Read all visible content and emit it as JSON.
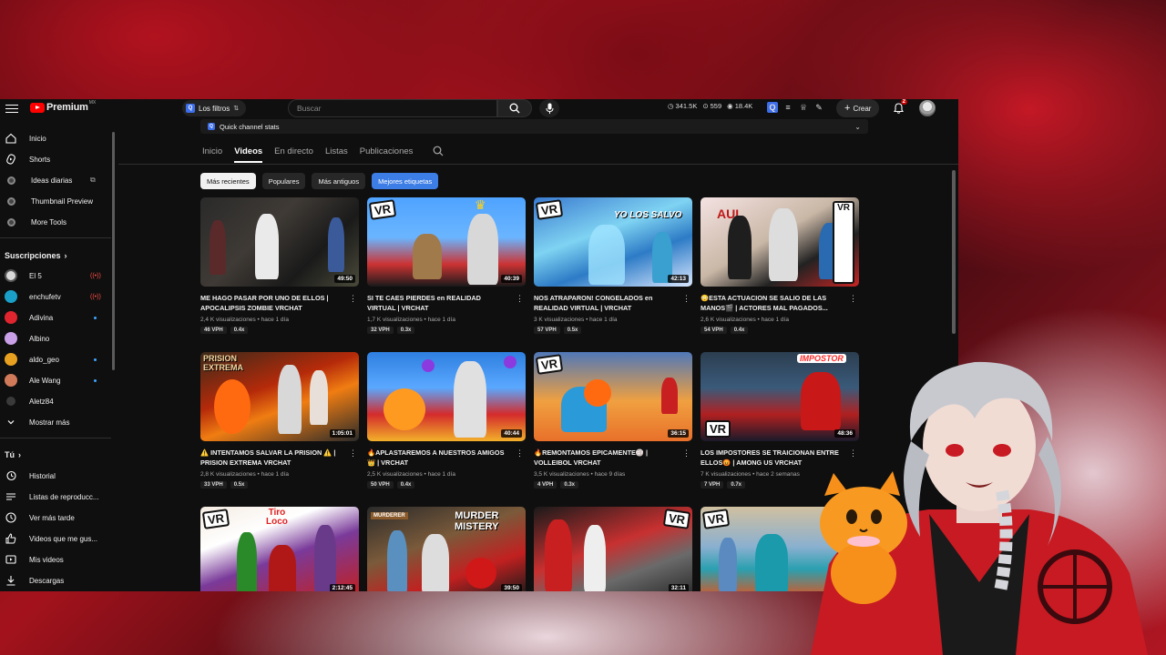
{
  "header": {
    "logo_text": "Premium",
    "logo_sup": "MX",
    "filters_label": "Los filtros",
    "search_placeholder": "Buscar",
    "stats": [
      "341.5K",
      "559",
      "18.4K"
    ],
    "create_label": "Crear",
    "notifications_count": "2"
  },
  "sidebar": {
    "main": [
      {
        "label": "Inicio",
        "icon": "home-icon"
      },
      {
        "label": "Shorts",
        "icon": "shorts-icon"
      },
      {
        "label": "Ideas diarias",
        "icon": "extension-icon"
      },
      {
        "label": "Thumbnail Preview",
        "icon": "extension-icon"
      },
      {
        "label": "More Tools",
        "icon": "extension-icon"
      }
    ],
    "subs_title": "Suscripciones",
    "subs": [
      {
        "label": "El 5",
        "status": "live",
        "color": "#d9d9d9"
      },
      {
        "label": "enchufetv",
        "status": "live",
        "color": "#1aa0c8"
      },
      {
        "label": "Adivina",
        "status": "dot",
        "color": "#e0252f"
      },
      {
        "label": "Albino",
        "status": "",
        "color": "#c9a0e8"
      },
      {
        "label": "aldo_geo",
        "status": "dot",
        "color": "#e8a020"
      },
      {
        "label": "Ale Wang",
        "status": "dot",
        "color": "#d07a5a"
      },
      {
        "label": "Aletz84",
        "status": "",
        "color": "#3a3a3a"
      }
    ],
    "show_more": "Mostrar más",
    "you_title": "Tú",
    "you": [
      {
        "label": "Historial",
        "icon": "history-icon"
      },
      {
        "label": "Listas de reproducc...",
        "icon": "playlist-icon"
      },
      {
        "label": "Ver más tarde",
        "icon": "clock-icon"
      },
      {
        "label": "Videos que me gus...",
        "icon": "thumbs-up-icon"
      },
      {
        "label": "Mis videos",
        "icon": "my-videos-icon"
      },
      {
        "label": "Descargas",
        "icon": "download-icon"
      }
    ]
  },
  "channel": {
    "quick_stats": "Quick channel stats",
    "tabs": [
      "Inicio",
      "Videos",
      "En directo",
      "Listas",
      "Publicaciones"
    ],
    "active_tab": "Videos",
    "chips": [
      "Más recientes",
      "Populares",
      "Más antiguos",
      "Mejores etiquetas"
    ]
  },
  "videos": [
    {
      "title": "ME HAGO PASAR POR UNO DE ELLOS | APOCALIPSIS ZOMBIE VRCHAT",
      "duration": "49:50",
      "views": "2,4 K visualizaciones",
      "age": "hace 1 día",
      "vph": "46 VPH",
      "ratio": "0.4x"
    },
    {
      "title": "SI TE CAES PIERDES en REALIDAD VIRTUAL | VRCHAT",
      "duration": "40:39",
      "views": "1,7 K visualizaciones",
      "age": "hace 1 día",
      "vph": "32 VPH",
      "ratio": "0.3x"
    },
    {
      "title": "NOS ATRAPARON! CONGELADOS en REALIDAD VIRTUAL | VRCHAT",
      "duration": "42:13",
      "views": "3 K visualizaciones",
      "age": "hace 1 día",
      "vph": "57 VPH",
      "ratio": "0.5x"
    },
    {
      "title": "😳ESTA ACTUACION SE SALIO DE LAS MANOS🎬 | ACTORES MAL PAGADOS...",
      "duration": "",
      "views": "2,6 K visualizaciones",
      "age": "hace 1 día",
      "vph": "54 VPH",
      "ratio": "0.4x"
    },
    {
      "title": "⚠️ INTENTAMOS SALVAR LA PRISION ⚠️ | PRISION EXTREMA VRCHAT",
      "duration": "1:05:01",
      "views": "2,8 K visualizaciones",
      "age": "hace 1 día",
      "vph": "33 VPH",
      "ratio": "0.5x"
    },
    {
      "title": "🔥APLASTAREMOS A NUESTROS AMIGOS👑 | VRCHAT",
      "duration": "40:44",
      "views": "2,5 K visualizaciones",
      "age": "hace 1 día",
      "vph": "50 VPH",
      "ratio": "0.4x"
    },
    {
      "title": "🔥REMONTAMOS EPICAMENTE🏐 | VOLLEIBOL VRCHAT",
      "duration": "36:15",
      "views": "3,5 K visualizaciones",
      "age": "hace 9 días",
      "vph": "4 VPH",
      "ratio": "0.3x"
    },
    {
      "title": "LOS IMPOSTORES SE TRAICIONAN ENTRE ELLOS😡 | AMONG US VRCHAT",
      "duration": "48:36",
      "views": "7 K visualizaciones",
      "age": "hace 2 semanas",
      "vph": "7 VPH",
      "ratio": "0.7x"
    },
    {
      "title": "",
      "duration": "2:12:45",
      "views": "",
      "age": "",
      "vph": "",
      "ratio": ""
    },
    {
      "title": "",
      "duration": "39:50",
      "views": "",
      "age": "",
      "vph": "",
      "ratio": ""
    },
    {
      "title": "",
      "duration": "32:11",
      "views": "",
      "age": "",
      "vph": "",
      "ratio": ""
    },
    {
      "title": "",
      "duration": "",
      "views": "",
      "age": "",
      "vph": "",
      "ratio": ""
    }
  ],
  "thumb_text": {
    "vr": "VR",
    "yo_los_salvo": "YO LOS SALVO",
    "aul": "AUL",
    "prision": "PRISION",
    "extrema": "EXTREMA",
    "impostor": "IMPOSTOR",
    "tiro": "Tiro",
    "loco": "Loco",
    "murderer": "MURDERER",
    "murder": "MURDER",
    "mistery": "MISTERY"
  },
  "colors": {
    "accent": "#ff0000",
    "chip_ext": "#3d7ee6",
    "live": "#ff4e45",
    "dot": "#3ea6ff"
  }
}
